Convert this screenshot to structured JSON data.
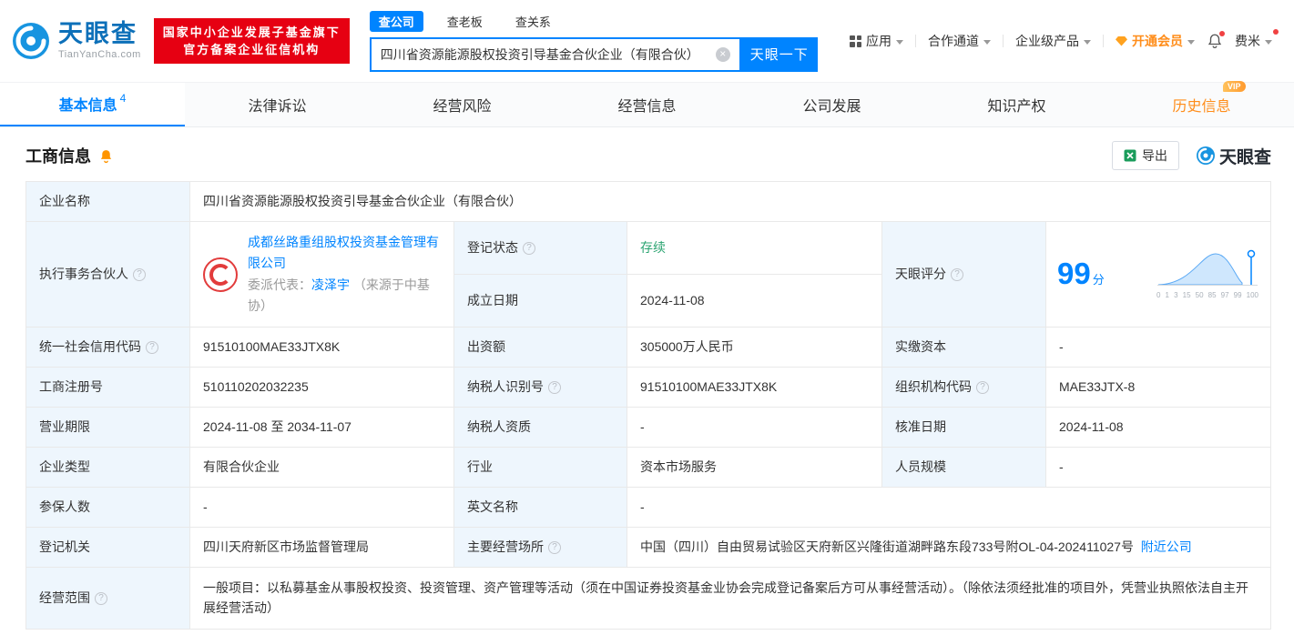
{
  "header": {
    "logo_title": "天眼查",
    "logo_sub": "TianYanCha.com",
    "badge_line1": "国家中小企业发展子基金旗下",
    "badge_line2": "官方备案企业征信机构",
    "search_tabs": [
      {
        "label": "查公司"
      },
      {
        "label": "查老板"
      },
      {
        "label": "查关系"
      }
    ],
    "search_value": "四川省资源能源股权投资引导基金合伙企业（有限合伙）",
    "search_button": "天眼一下",
    "nav_app": "应用",
    "nav_coop": "合作通道",
    "nav_enterprise": "企业级产品",
    "nav_vip": "开通会员",
    "nav_user": "费米"
  },
  "tabs": {
    "basic": "基本信息",
    "basic_count": "4",
    "legal": "法律诉讼",
    "risk": "经营风险",
    "operation": "经营信息",
    "development": "公司发展",
    "ip": "知识产权",
    "history": "历史信息",
    "vip_badge": "VIP"
  },
  "section": {
    "title": "工商信息",
    "export_label": "导出",
    "watermark": "天眼查"
  },
  "info": {
    "company_name_label": "企业名称",
    "company_name": "四川省资源能源股权投资引导基金合伙企业（有限合伙）",
    "partner_label": "执行事务合伙人",
    "partner_company": "成都丝路重组股权投资基金管理有限公司",
    "partner_rep_label": "委派代表：",
    "partner_rep": "凌泽宇",
    "partner_rep_source": "（来源于中基协）",
    "reg_status_label": "登记状态",
    "reg_status": "存续",
    "establish_label": "成立日期",
    "establish_date": "2024-11-08",
    "score_label": "天眼评分",
    "score_value": "99",
    "score_unit": "分",
    "score_axis": [
      "0",
      "1",
      "3",
      "15",
      "50",
      "85",
      "97",
      "99",
      "100"
    ],
    "credit_code_label": "统一社会信用代码",
    "credit_code": "91510100MAE33JTX8K",
    "capital_label": "出资额",
    "capital": "305000万人民币",
    "paid_label": "实缴资本",
    "paid": "-",
    "reg_no_label": "工商注册号",
    "reg_no": "510110202032235",
    "tax_id_label": "纳税人识别号",
    "tax_id": "91510100MAE33JTX8K",
    "org_code_label": "组织机构代码",
    "org_code": "MAE33JTX-8",
    "term_label": "营业期限",
    "term": "2024-11-08 至 2034-11-07",
    "tax_qual_label": "纳税人资质",
    "tax_qual": "-",
    "approve_label": "核准日期",
    "approve_date": "2024-11-08",
    "type_label": "企业类型",
    "type": "有限合伙企业",
    "industry_label": "行业",
    "industry": "资本市场服务",
    "staff_label": "人员规模",
    "staff": "-",
    "insured_label": "参保人数",
    "insured": "-",
    "en_name_label": "英文名称",
    "en_name": "-",
    "authority_label": "登记机关",
    "authority": "四川天府新区市场监督管理局",
    "address_label": "主要经营场所",
    "address": "中国（四川）自由贸易试验区天府新区兴隆街道湖畔路东段733号附OL-04-202411027号",
    "nearby_link": "附近公司",
    "scope_label": "经营范围",
    "scope": "一般项目：以私募基金从事股权投资、投资管理、资产管理等活动（须在中国证券投资基金业协会完成登记备案后方可从事经营活动）。（除依法须经批准的项目外，凭营业执照依法自主开展经营活动）"
  }
}
